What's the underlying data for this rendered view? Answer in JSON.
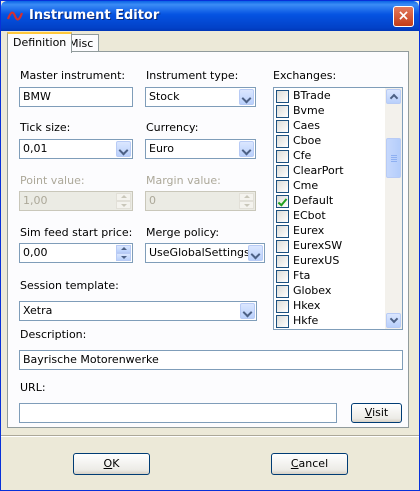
{
  "window": {
    "title": "Instrument Editor",
    "close_glyph": "×"
  },
  "tabs": [
    {
      "label": "Definition",
      "active": true
    },
    {
      "label": "Misc",
      "active": false
    }
  ],
  "fields": {
    "master_instrument": {
      "label": "Master instrument:",
      "value": "BMW"
    },
    "instrument_type": {
      "label": "Instrument type:",
      "value": "Stock"
    },
    "tick_size": {
      "label": "Tick size:",
      "value": "0,01"
    },
    "currency": {
      "label": "Currency:",
      "value": "Euro"
    },
    "point_value": {
      "label": "Point value:",
      "value": "1,00",
      "disabled": true
    },
    "margin_value": {
      "label": "Margin value:",
      "value": "0",
      "disabled": true
    },
    "sim_feed_start_price": {
      "label": "Sim feed start price:",
      "value": "0,00"
    },
    "merge_policy": {
      "label": "Merge policy:",
      "value": "UseGlobalSettings"
    },
    "session_template": {
      "label": "Session template:",
      "value": "Xetra"
    },
    "description": {
      "label": "Description:",
      "value": "Bayrische Motorenwerke"
    },
    "url": {
      "label": "URL:",
      "value": ""
    }
  },
  "exchanges": {
    "label": "Exchanges:",
    "items": [
      {
        "name": "BTrade",
        "checked": false
      },
      {
        "name": "Bvme",
        "checked": false
      },
      {
        "name": "Caes",
        "checked": false
      },
      {
        "name": "Cboe",
        "checked": false
      },
      {
        "name": "Cfe",
        "checked": false
      },
      {
        "name": "ClearPort",
        "checked": false
      },
      {
        "name": "Cme",
        "checked": false
      },
      {
        "name": "Default",
        "checked": true
      },
      {
        "name": "ECbot",
        "checked": false
      },
      {
        "name": "Eurex",
        "checked": false
      },
      {
        "name": "EurexSW",
        "checked": false
      },
      {
        "name": "EurexUS",
        "checked": false
      },
      {
        "name": "Fta",
        "checked": false
      },
      {
        "name": "Globex",
        "checked": false
      },
      {
        "name": "Hkex",
        "checked": false
      },
      {
        "name": "Hkfe",
        "checked": false
      }
    ]
  },
  "buttons": {
    "visit": {
      "label": "Visit",
      "hotkey": "V",
      "rest": "isit"
    },
    "ok": {
      "label": "OK",
      "hotkey": "O",
      "rest": "K"
    },
    "cancel": {
      "label": "Cancel",
      "hotkey": "C",
      "rest": "ancel"
    }
  },
  "colors": {
    "title_bar": "#0553e2",
    "face": "#ece9d8",
    "panel": "#fcfcfe",
    "field_border": "#7f9db9",
    "check_green": "#21a121",
    "app_icon": "#d32f2f"
  },
  "icons": {
    "app": "nt-logo-icon",
    "close": "close-icon",
    "dropdown": "chevron-down-icon",
    "spin": "spin-arrows-icon",
    "check": "check-icon"
  }
}
